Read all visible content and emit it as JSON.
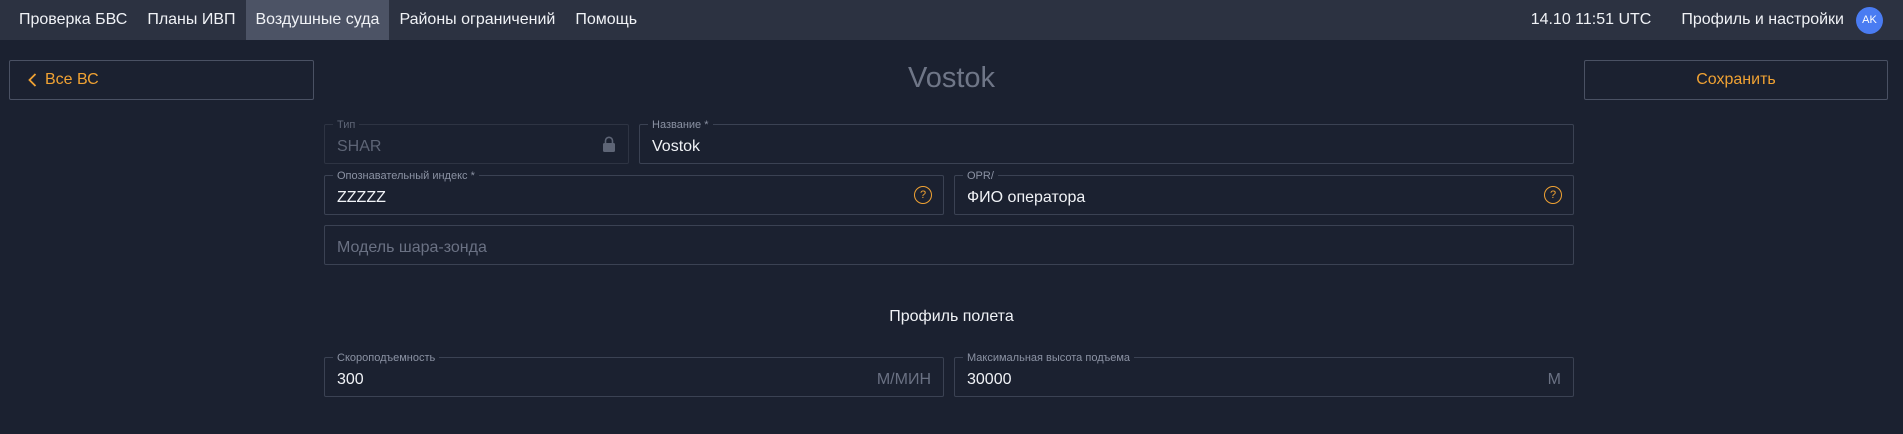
{
  "nav": {
    "items": [
      {
        "label": "Проверка БВС",
        "active": false
      },
      {
        "label": "Планы ИВП",
        "active": false
      },
      {
        "label": "Воздушные суда",
        "active": true
      },
      {
        "label": "Районы ограничений",
        "active": false
      },
      {
        "label": "Помощь",
        "active": false
      }
    ],
    "clock": "14.10 11:51 UTC",
    "profile_label": "Профиль и настройки",
    "avatar_initials": "AK"
  },
  "header": {
    "back_label": "Все ВС",
    "title": "Vostok",
    "save_label": "Сохранить"
  },
  "form": {
    "type": {
      "label": "Тип",
      "value": "SHAR",
      "locked": true
    },
    "name": {
      "label": "Название *",
      "value": "Vostok"
    },
    "callsign": {
      "label": "Опознавательный индекс *",
      "value": "ZZZZZ",
      "help": "?"
    },
    "opr": {
      "label": "OPR/",
      "value": "ФИО оператора",
      "help": "?"
    },
    "model": {
      "placeholder": "Модель шара-зонда"
    }
  },
  "flight_profile": {
    "title": "Профиль полета",
    "climb_rate": {
      "label": "Скороподъемность",
      "value": "300",
      "unit": "М/МИН"
    },
    "max_altitude": {
      "label": "Максимальная высота подъема",
      "value": "30000",
      "unit": "М"
    }
  },
  "colors": {
    "background": "#1b2130",
    "topbar": "#2c3241",
    "active_tab": "#4c5365",
    "accent": "#f0a233",
    "avatar": "#4a7cf2"
  }
}
